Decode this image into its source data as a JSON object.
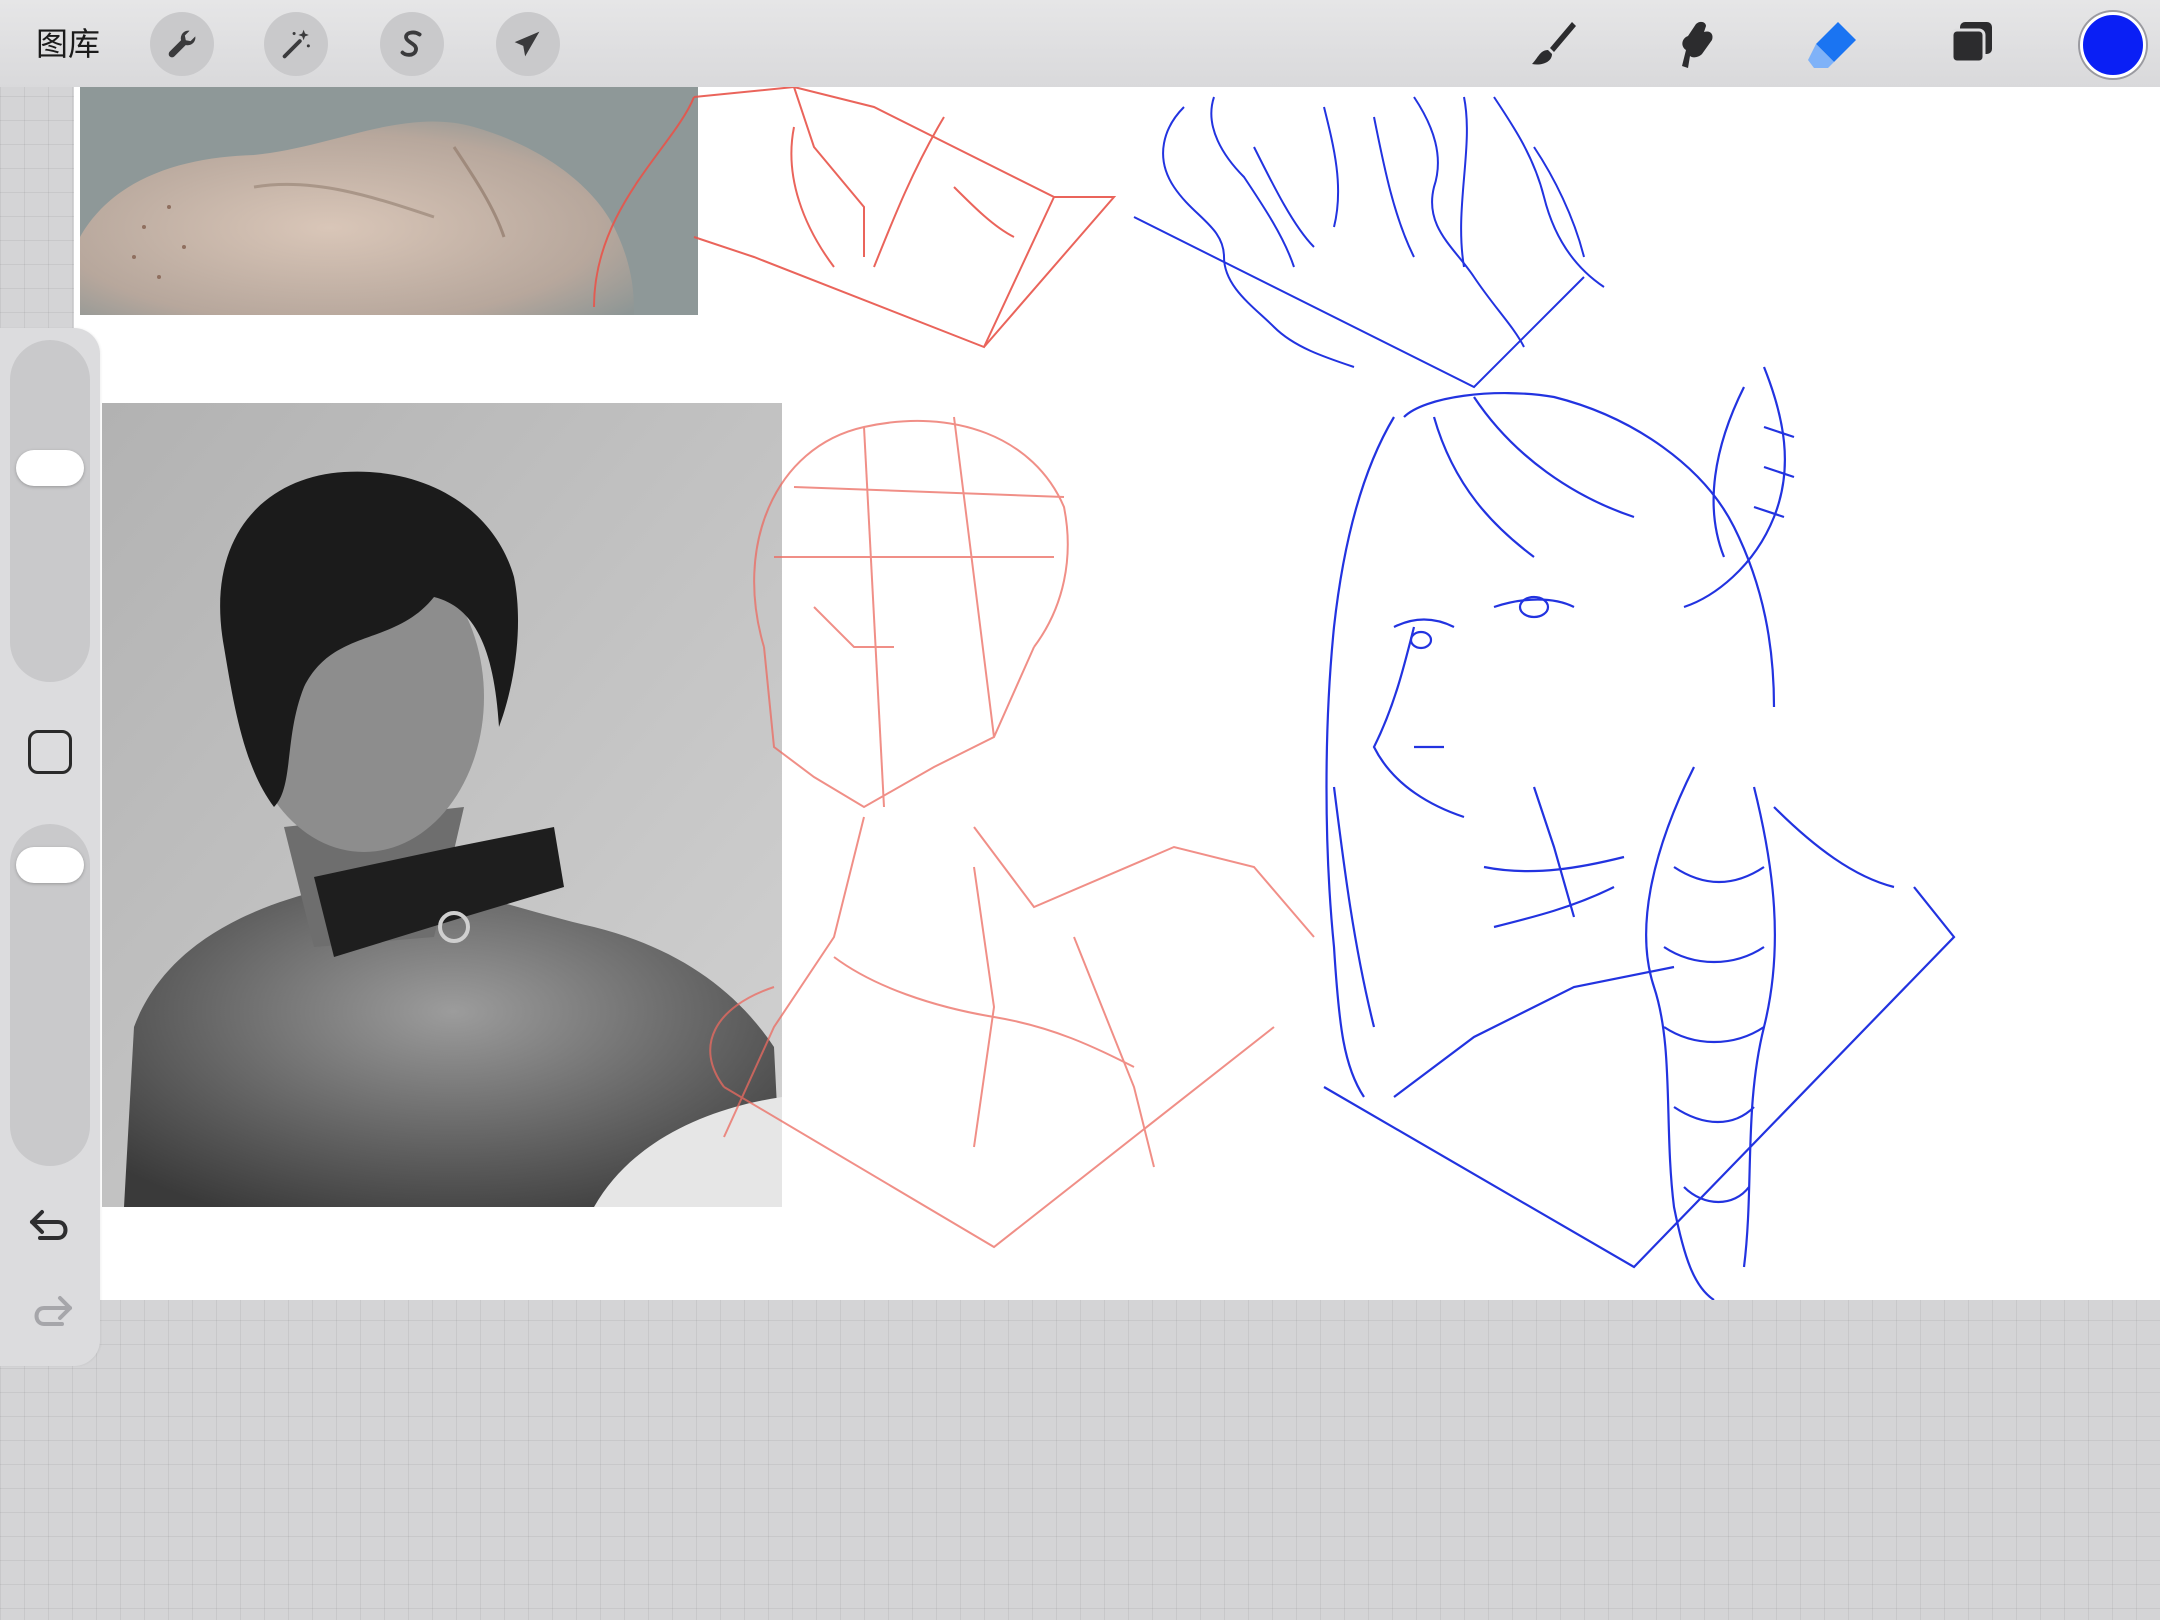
{
  "toolbar": {
    "gallery_label": "图库",
    "left_tools": [
      {
        "name": "actions",
        "icon": "wrench-icon"
      },
      {
        "name": "adjustments",
        "icon": "magic-wand-icon"
      },
      {
        "name": "selection",
        "icon": "selection-s-icon"
      },
      {
        "name": "transform",
        "icon": "arrow-cursor-icon"
      }
    ],
    "right_tools": [
      {
        "name": "brush",
        "icon": "brush-icon",
        "active": false
      },
      {
        "name": "smudge",
        "icon": "smudge-finger-icon",
        "active": false
      },
      {
        "name": "eraser",
        "icon": "eraser-icon",
        "active": true
      },
      {
        "name": "layers",
        "icon": "layers-icon",
        "active": false
      }
    ],
    "current_color": "#0a1ff5"
  },
  "colors": {
    "accent": "#1a74f2",
    "sketch_blue": "#2233e0",
    "sketch_red": "#e8544a"
  },
  "sidebar": {
    "brush_size_level": 0.65,
    "opacity_level": 0.95,
    "modify_icon": "square-icon",
    "undo_icon": "undo-icon",
    "redo_icon": "redo-icon"
  }
}
